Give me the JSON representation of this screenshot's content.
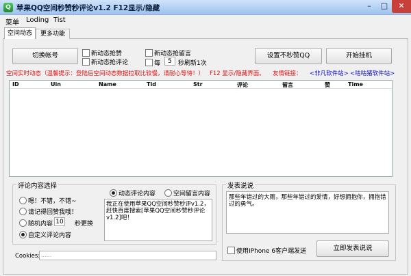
{
  "window": {
    "title": "苹果QQ空间秒赞秒评论v1.2  F12显示/隐藏",
    "icon_glyph": "Q",
    "min_glyph": "–",
    "max_glyph": "□",
    "close_glyph": "✕"
  },
  "menu": [
    "菜单",
    "Loding",
    "Tist"
  ],
  "tabs": [
    {
      "label": "空间动态",
      "active": true
    },
    {
      "label": "更多功能",
      "active": false
    }
  ],
  "controls": {
    "switch_account": "切换帐号",
    "cb_dynamic_like": "新动态抢赞",
    "cb_dynamic_comment": "新动态抢评论",
    "cb_dynamic_message": "新动态抢留言",
    "every_prefix": "每",
    "interval": "5",
    "every_suffix": "秒刷新1次",
    "set_no_like_qq": "设置不秒赞QQ",
    "start_hang": "开始挂机"
  },
  "status_line": {
    "label": "空间实时动态（温馨提示：登陆后空间动态数据拉取比较慢，请耐心等待！）",
    "f12_hint": "F12 显示/隐藏界面。",
    "links_label": "友情链接：",
    "link1": "<非凡软件站>",
    "link2": "<咕咕猪软件站>"
  },
  "table": {
    "columns": [
      "ID",
      "Uin",
      "Name",
      "Tid",
      "Str",
      "评论",
      "留言",
      "赞",
      "Time"
    ]
  },
  "comment_group": {
    "title": "评论内容选择",
    "options": [
      "嗯！不错，不错~",
      "请记得回赞我哦！",
      "随机内容",
      "自定义评论内容"
    ],
    "random_count": "10",
    "random_suffix": "秒更换",
    "selected_option": 3,
    "mode_dynamic": "动态评论内容",
    "mode_message": "空间留言内容",
    "text": "我正在使用苹果QQ空间秒赞秒评v1.2，赶快百度搜索[苹果QQ空间秒赞秒评论v1.2]吧！"
  },
  "post_group": {
    "title": "发表说说",
    "text": "那些年错过的大雨，那些年错过的爱情，好想拥抱你，拥抱错过的勇气。",
    "iphone_checkbox": "使用IPhone 6客户端发送",
    "post_button": "立即发表说说"
  },
  "cookies": {
    "label": "Cookies:",
    "value": "......"
  },
  "colors": {
    "status_red": "#e01010",
    "link_blue": "#1010d0"
  }
}
